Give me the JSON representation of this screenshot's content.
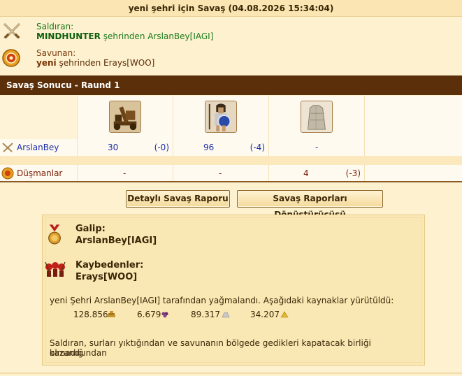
{
  "report": {
    "title": "yeni şehri için Savaş (04.08.2026 15:34:04)"
  },
  "attacker": {
    "label": "Saldıran:",
    "player": "MINDHUNTER",
    "city_text": "şehrinden ArslanBey[IAGI]"
  },
  "defender": {
    "label": "Savunan:",
    "city": "yeni",
    "city_text": "şehrinden Erays[WOO]"
  },
  "round": {
    "title": "Savaş Sonucu - Raund 1"
  },
  "units": [
    {
      "icon": "catapult-unit-icon"
    },
    {
      "icon": "hoplite-unit-icon"
    },
    {
      "icon": "wall-unit-icon"
    }
  ],
  "rows": [
    {
      "name": "ArslanBey",
      "values": [
        {
          "count": "30",
          "loss": "(-0)"
        },
        {
          "count": "96",
          "loss": "(-4)"
        },
        {
          "count": "-",
          "loss": ""
        }
      ]
    },
    {
      "name": "Düşmanlar",
      "values": [
        {
          "count": "-",
          "loss": ""
        },
        {
          "count": "-",
          "loss": ""
        },
        {
          "count": "4",
          "loss": "(-3)"
        }
      ]
    }
  ],
  "buttons": {
    "detailed": "Detaylı Savaş Raporu",
    "converter": "Savaş Raporları Dönüştürücüsü"
  },
  "result": {
    "winner_label": "Galip:",
    "winner_name": "ArslanBey[IAGI]",
    "losers_label": "Kaybedenler:",
    "losers_name": "Erays[WOO]",
    "plunder_text": "yeni Şehri ArslanBey[IAGI] tarafından yağmalandı. Aşağıdaki kaynaklar yürütüldü:",
    "resources": [
      {
        "value": "128.856",
        "icon": "wood-icon",
        "color": "#c8962c"
      },
      {
        "value": "6.679",
        "icon": "wine-icon",
        "color": "#7a3a7a"
      },
      {
        "value": "89.317",
        "icon": "marble-icon",
        "color": "#b8b8b8"
      },
      {
        "value": "34.207",
        "icon": "sulfur-icon",
        "color": "#e0b830"
      }
    ],
    "footer_line1": "Saldıran, surları yıktığından ve savunanın bölgede gedikleri kapatacak birliği olmadığından",
    "footer_line2": "kazandı."
  },
  "colors": {
    "header": "#5a2f0a",
    "background": "#fdf1cf",
    "attacker_name": "#1b2ea8",
    "enemy_name": "#7a1d05"
  }
}
